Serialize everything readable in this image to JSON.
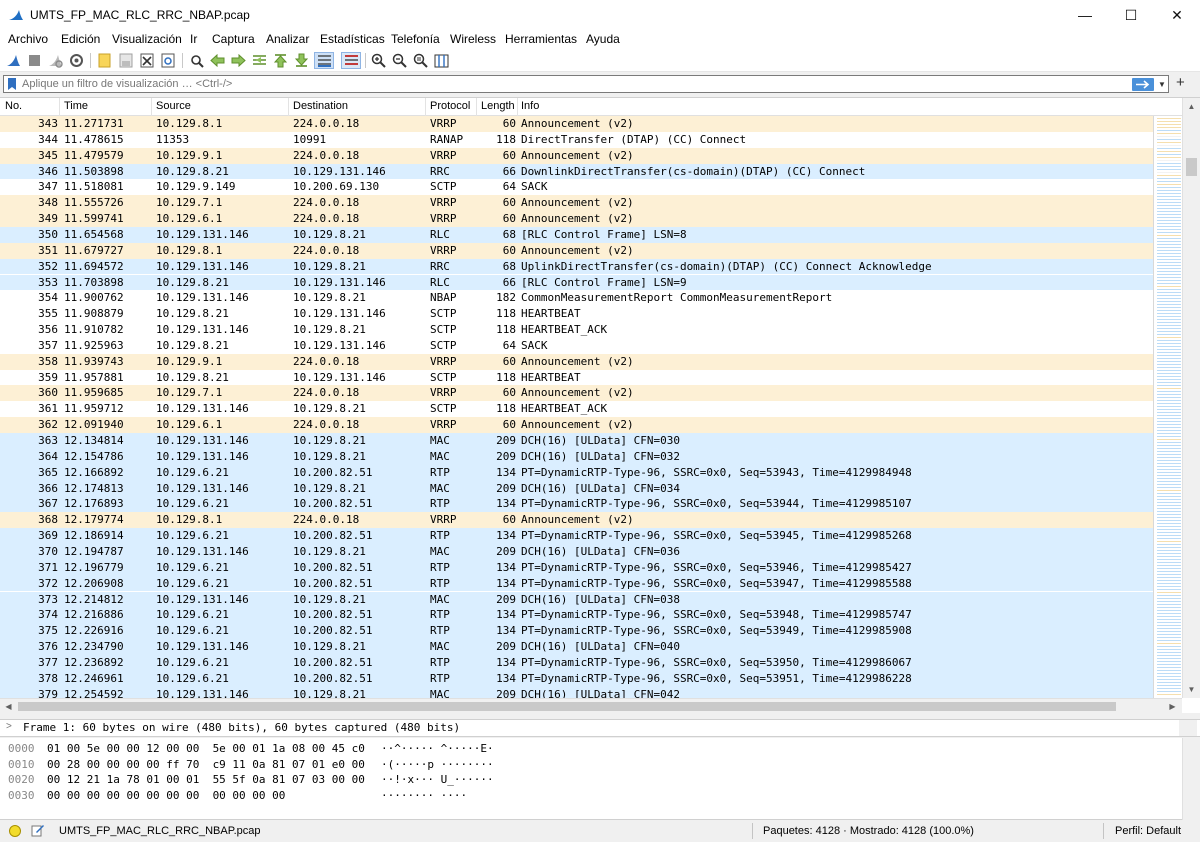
{
  "window": {
    "title": "UMTS_FP_MAC_RLC_RRC_NBAP.pcap",
    "minimize_glyph": "—",
    "maximize_glyph": "☐",
    "close_glyph": "✕"
  },
  "menu": [
    "Archivo",
    "Edición",
    "Visualización",
    "Ir",
    "Captura",
    "Analizar",
    "Estadísticas",
    "Telefonía",
    "Wireless",
    "Herramientas",
    "Ayuda"
  ],
  "toolbar_icons": [
    "start-capture-icon",
    "stop-capture-icon",
    "restart-capture-icon",
    "capture-options-icon",
    "open-file-icon",
    "save-file-icon",
    "close-file-icon",
    "reload-file-icon",
    "find-packet-icon",
    "go-back-icon",
    "go-forward-icon",
    "go-to-packet-icon",
    "first-packet-icon",
    "last-packet-icon",
    "auto-scroll-icon",
    "colorize-icon",
    "zoom-in-icon",
    "zoom-out-icon",
    "zoom-reset-icon",
    "resize-columns-icon"
  ],
  "filter": {
    "placeholder": "Aplique un filtro de visualización … <Ctrl-/>",
    "plus": "+"
  },
  "columns": {
    "no": "No.",
    "time": "Time",
    "source": "Source",
    "destination": "Destination",
    "protocol": "Protocol",
    "length": "Length",
    "info": "Info"
  },
  "colors": {
    "row_yellow": "#fdf0d5",
    "row_blue": "#daeeff",
    "row_white": "#ffffff",
    "accent_blue": "#4a90d9"
  },
  "packets": [
    {
      "no": "343",
      "time": "11.271731",
      "src": "10.129.8.1",
      "dst": "224.0.0.18",
      "proto": "VRRP",
      "len": "60",
      "info": "Announcement (v2)",
      "color": "yellow"
    },
    {
      "no": "344",
      "time": "11.478615",
      "src": "11353",
      "dst": "10991",
      "proto": "RANAP",
      "len": "118",
      "info": "DirectTransfer (DTAP) (CC) Connect",
      "color": "white"
    },
    {
      "no": "345",
      "time": "11.479579",
      "src": "10.129.9.1",
      "dst": "224.0.0.18",
      "proto": "VRRP",
      "len": "60",
      "info": "Announcement (v2)",
      "color": "yellow"
    },
    {
      "no": "346",
      "time": "11.503898",
      "src": "10.129.8.21",
      "dst": "10.129.131.146",
      "proto": "RRC",
      "len": "66",
      "info": "DownlinkDirectTransfer(cs-domain)(DTAP) (CC) Connect",
      "color": "blue"
    },
    {
      "no": "347",
      "time": "11.518081",
      "src": "10.129.9.149",
      "dst": "10.200.69.130",
      "proto": "SCTP",
      "len": "64",
      "info": "SACK",
      "color": "white"
    },
    {
      "no": "348",
      "time": "11.555726",
      "src": "10.129.7.1",
      "dst": "224.0.0.18",
      "proto": "VRRP",
      "len": "60",
      "info": "Announcement (v2)",
      "color": "yellow"
    },
    {
      "no": "349",
      "time": "11.599741",
      "src": "10.129.6.1",
      "dst": "224.0.0.18",
      "proto": "VRRP",
      "len": "60",
      "info": "Announcement (v2)",
      "color": "yellow"
    },
    {
      "no": "350",
      "time": "11.654568",
      "src": "10.129.131.146",
      "dst": "10.129.8.21",
      "proto": "RLC",
      "len": "68",
      "info": "[RLC Control Frame] LSN=8",
      "color": "blue"
    },
    {
      "no": "351",
      "time": "11.679727",
      "src": "10.129.8.1",
      "dst": "224.0.0.18",
      "proto": "VRRP",
      "len": "60",
      "info": "Announcement (v2)",
      "color": "yellow"
    },
    {
      "no": "352",
      "time": "11.694572",
      "src": "10.129.131.146",
      "dst": "10.129.8.21",
      "proto": "RRC",
      "len": "68",
      "info": "UplinkDirectTransfer(cs-domain)(DTAP) (CC) Connect Acknowledge",
      "color": "blue"
    },
    {
      "no": "353",
      "time": "11.703898",
      "src": "10.129.8.21",
      "dst": "10.129.131.146",
      "proto": "RLC",
      "len": "66",
      "info": "[RLC Control Frame] LSN=9",
      "color": "blue"
    },
    {
      "no": "354",
      "time": "11.900762",
      "src": "10.129.131.146",
      "dst": "10.129.8.21",
      "proto": "NBAP",
      "len": "182",
      "info": "CommonMeasurementReport CommonMeasurementReport",
      "color": "white"
    },
    {
      "no": "355",
      "time": "11.908879",
      "src": "10.129.8.21",
      "dst": "10.129.131.146",
      "proto": "SCTP",
      "len": "118",
      "info": "HEARTBEAT",
      "color": "white"
    },
    {
      "no": "356",
      "time": "11.910782",
      "src": "10.129.131.146",
      "dst": "10.129.8.21",
      "proto": "SCTP",
      "len": "118",
      "info": "HEARTBEAT_ACK",
      "color": "white"
    },
    {
      "no": "357",
      "time": "11.925963",
      "src": "10.129.8.21",
      "dst": "10.129.131.146",
      "proto": "SCTP",
      "len": "64",
      "info": "SACK",
      "color": "white"
    },
    {
      "no": "358",
      "time": "11.939743",
      "src": "10.129.9.1",
      "dst": "224.0.0.18",
      "proto": "VRRP",
      "len": "60",
      "info": "Announcement (v2)",
      "color": "yellow"
    },
    {
      "no": "359",
      "time": "11.957881",
      "src": "10.129.8.21",
      "dst": "10.129.131.146",
      "proto": "SCTP",
      "len": "118",
      "info": "HEARTBEAT",
      "color": "white"
    },
    {
      "no": "360",
      "time": "11.959685",
      "src": "10.129.7.1",
      "dst": "224.0.0.18",
      "proto": "VRRP",
      "len": "60",
      "info": "Announcement (v2)",
      "color": "yellow"
    },
    {
      "no": "361",
      "time": "11.959712",
      "src": "10.129.131.146",
      "dst": "10.129.8.21",
      "proto": "SCTP",
      "len": "118",
      "info": "HEARTBEAT_ACK",
      "color": "white"
    },
    {
      "no": "362",
      "time": "12.091940",
      "src": "10.129.6.1",
      "dst": "224.0.0.18",
      "proto": "VRRP",
      "len": "60",
      "info": "Announcement (v2)",
      "color": "yellow"
    },
    {
      "no": "363",
      "time": "12.134814",
      "src": "10.129.131.146",
      "dst": "10.129.8.21",
      "proto": "MAC",
      "len": "209",
      "info": "DCH(16)  [ULData] CFN=030",
      "color": "blue"
    },
    {
      "no": "364",
      "time": "12.154786",
      "src": "10.129.131.146",
      "dst": "10.129.8.21",
      "proto": "MAC",
      "len": "209",
      "info": "DCH(16)  [ULData] CFN=032",
      "color": "blue"
    },
    {
      "no": "365",
      "time": "12.166892",
      "src": "10.129.6.21",
      "dst": "10.200.82.51",
      "proto": "RTP",
      "len": "134",
      "info": "PT=DynamicRTP-Type-96, SSRC=0x0, Seq=53943, Time=4129984948",
      "color": "blue"
    },
    {
      "no": "366",
      "time": "12.174813",
      "src": "10.129.131.146",
      "dst": "10.129.8.21",
      "proto": "MAC",
      "len": "209",
      "info": "DCH(16)  [ULData] CFN=034",
      "color": "blue"
    },
    {
      "no": "367",
      "time": "12.176893",
      "src": "10.129.6.21",
      "dst": "10.200.82.51",
      "proto": "RTP",
      "len": "134",
      "info": "PT=DynamicRTP-Type-96, SSRC=0x0, Seq=53944, Time=4129985107",
      "color": "blue"
    },
    {
      "no": "368",
      "time": "12.179774",
      "src": "10.129.8.1",
      "dst": "224.0.0.18",
      "proto": "VRRP",
      "len": "60",
      "info": "Announcement (v2)",
      "color": "yellow"
    },
    {
      "no": "369",
      "time": "12.186914",
      "src": "10.129.6.21",
      "dst": "10.200.82.51",
      "proto": "RTP",
      "len": "134",
      "info": "PT=DynamicRTP-Type-96, SSRC=0x0, Seq=53945, Time=4129985268",
      "color": "blue"
    },
    {
      "no": "370",
      "time": "12.194787",
      "src": "10.129.131.146",
      "dst": "10.129.8.21",
      "proto": "MAC",
      "len": "209",
      "info": "DCH(16)  [ULData] CFN=036",
      "color": "blue"
    },
    {
      "no": "371",
      "time": "12.196779",
      "src": "10.129.6.21",
      "dst": "10.200.82.51",
      "proto": "RTP",
      "len": "134",
      "info": "PT=DynamicRTP-Type-96, SSRC=0x0, Seq=53946, Time=4129985427",
      "color": "blue"
    },
    {
      "no": "372",
      "time": "12.206908",
      "src": "10.129.6.21",
      "dst": "10.200.82.51",
      "proto": "RTP",
      "len": "134",
      "info": "PT=DynamicRTP-Type-96, SSRC=0x0, Seq=53947, Time=4129985588",
      "color": "blue"
    },
    {
      "no": "373",
      "time": "12.214812",
      "src": "10.129.131.146",
      "dst": "10.129.8.21",
      "proto": "MAC",
      "len": "209",
      "info": "DCH(16)  [ULData] CFN=038",
      "color": "blue"
    },
    {
      "no": "374",
      "time": "12.216886",
      "src": "10.129.6.21",
      "dst": "10.200.82.51",
      "proto": "RTP",
      "len": "134",
      "info": "PT=DynamicRTP-Type-96, SSRC=0x0, Seq=53948, Time=4129985747",
      "color": "blue"
    },
    {
      "no": "375",
      "time": "12.226916",
      "src": "10.129.6.21",
      "dst": "10.200.82.51",
      "proto": "RTP",
      "len": "134",
      "info": "PT=DynamicRTP-Type-96, SSRC=0x0, Seq=53949, Time=4129985908",
      "color": "blue"
    },
    {
      "no": "376",
      "time": "12.234790",
      "src": "10.129.131.146",
      "dst": "10.129.8.21",
      "proto": "MAC",
      "len": "209",
      "info": "DCH(16)  [ULData] CFN=040",
      "color": "blue"
    },
    {
      "no": "377",
      "time": "12.236892",
      "src": "10.129.6.21",
      "dst": "10.200.82.51",
      "proto": "RTP",
      "len": "134",
      "info": "PT=DynamicRTP-Type-96, SSRC=0x0, Seq=53950, Time=4129986067",
      "color": "blue"
    },
    {
      "no": "378",
      "time": "12.246961",
      "src": "10.129.6.21",
      "dst": "10.200.82.51",
      "proto": "RTP",
      "len": "134",
      "info": "PT=DynamicRTP-Type-96, SSRC=0x0, Seq=53951, Time=4129986228",
      "color": "blue"
    },
    {
      "no": "379",
      "time": "12.254592",
      "src": "10.129.131.146",
      "dst": "10.129.8.21",
      "proto": "MAC",
      "len": "209",
      "info": "DCH(16)  [ULData] CFN=042",
      "color": "blue"
    }
  ],
  "details": {
    "frame_summary": "Frame 1: 60 bytes on wire (480 bits), 60 bytes captured (480 bits)"
  },
  "bytes": [
    {
      "offset": "0000",
      "hex": "01 00 5e 00 00 12 00 00  5e 00 01 1a 08 00 45 c0",
      "ascii": "··^····· ^·····E·"
    },
    {
      "offset": "0010",
      "hex": "00 28 00 00 00 00 ff 70  c9 11 0a 81 07 01 e0 00",
      "ascii": "·(·····p ········"
    },
    {
      "offset": "0020",
      "hex": "00 12 21 1a 78 01 00 01  55 5f 0a 81 07 03 00 00",
      "ascii": "··!·x··· U_······"
    },
    {
      "offset": "0030",
      "hex": "00 00 00 00 00 00 00 00  00 00 00 00",
      "ascii": "········ ····"
    }
  ],
  "status": {
    "file": "UMTS_FP_MAC_RLC_RRC_NBAP.pcap",
    "packets": "Paquetes: 4128 · Mostrado: 4128 (100.0%)",
    "profile": "Perfil: Default"
  }
}
